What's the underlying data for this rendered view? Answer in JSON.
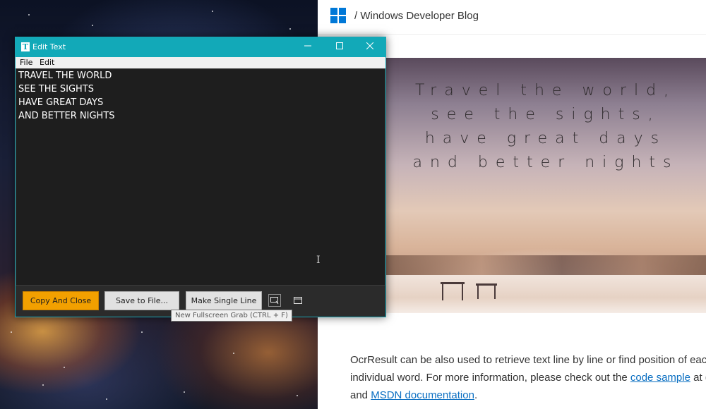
{
  "browser": {
    "blog_title": "/ Windows Developer Blog",
    "hero_lines": [
      "Travel the world,",
      "see the sights,",
      "have great days",
      "and better nights"
    ],
    "article": {
      "line1": "OcrResult can be also used to retrieve text line by line or find position of eac",
      "line2_prefix": "individual word. For more information, please check out the ",
      "code_sample_link": "code sample",
      "line2_suffix": " at (",
      "line3_prefix": "and ",
      "msdn_link": "MSDN documentation",
      "line3_suffix": "."
    }
  },
  "window": {
    "title": "Edit Text",
    "menu": {
      "file": "File",
      "edit": "Edit"
    },
    "text_lines": [
      "TRAVEL THE WORLD",
      "SEE THE SIGHTS",
      "HAVE GREAT DAYS",
      "AND BETTER NIGHTS"
    ],
    "buttons": {
      "copy_and_close": "Copy And Close",
      "save_to_file": "Save to File...",
      "make_single_line": "Make Single Line"
    },
    "tooltip": "New Fullscreen Grab (CTRL + F)",
    "colors": {
      "titlebar": "#12a9b8",
      "primary_button": "#f2a000"
    }
  }
}
